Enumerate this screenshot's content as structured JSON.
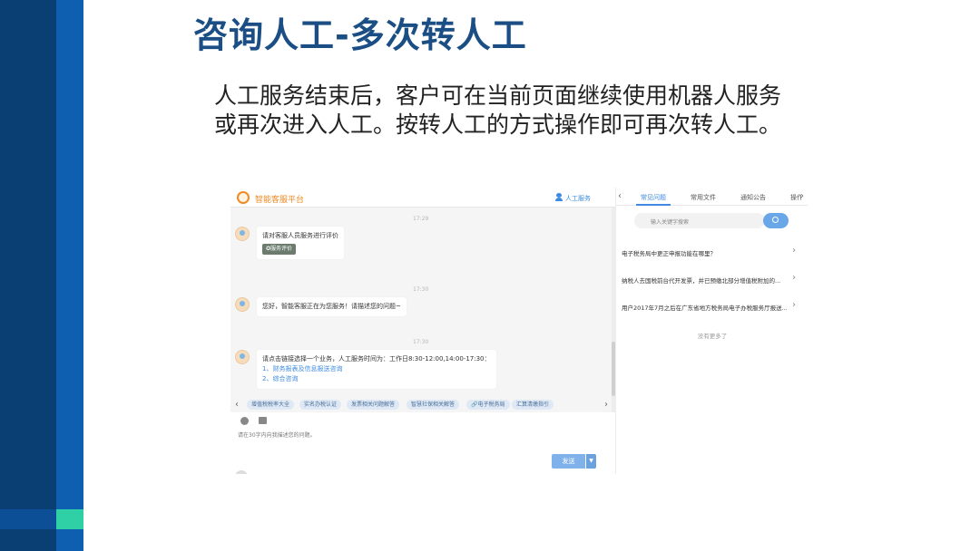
{
  "slide": {
    "title": "咨询人工-多次转人工",
    "text_line1": "人工服务结束后，客户可在当前页面继续使用机器人服务",
    "text_line2": "或再次进入人工。按转人工的方式操作即可再次转人工。"
  },
  "chat": {
    "platform_title": "智能客服平台",
    "human_service_label": "人工服务",
    "messages": [
      {
        "time": "17:29",
        "text": "请对客服人员服务进行评价",
        "button": "服务评价"
      },
      {
        "time": "17:30",
        "text": "您好，智能客服正在为您服务！请描述您的问题~"
      },
      {
        "time": "17:30",
        "text": "请点击链接选择一个业务，人工服务时间为：工作日8:30-12:00,14:00-17:30：",
        "links": [
          "1、财务报表及信息报送咨询",
          "2、综合咨询"
        ]
      }
    ],
    "quick_chips": [
      "增值税税率大全",
      "实名办税认证",
      "发票相关问题解答",
      "智慧社保相关解答",
      "电子税务局",
      "汇算清缴指引"
    ],
    "input_hint": "请在30字内向我描述您的问题。",
    "send_label": "发送",
    "send_dropdown": "▼"
  },
  "panel": {
    "tabs": [
      "常见问题",
      "常用文件",
      "通知公告",
      "操作"
    ],
    "search_placeholder": "输入关键字搜索",
    "questions": [
      "电子税务局中更正申报功能在哪里？",
      "纳税人去国税前台代开发票，并已预缴北部分增值税附加的...",
      "用户2017年7月之后在广东省地方税务局电子办税服务厅报送..."
    ],
    "no_more": "没有更多了"
  },
  "colors": {
    "title_blue": "#1a4e84",
    "accent_blue": "#3d8be0",
    "bar_dark": "#0a3f73",
    "bar_mid": "#0f5fb0",
    "bar_green": "#2fd0a6",
    "platform_orange": "#f08a24"
  }
}
